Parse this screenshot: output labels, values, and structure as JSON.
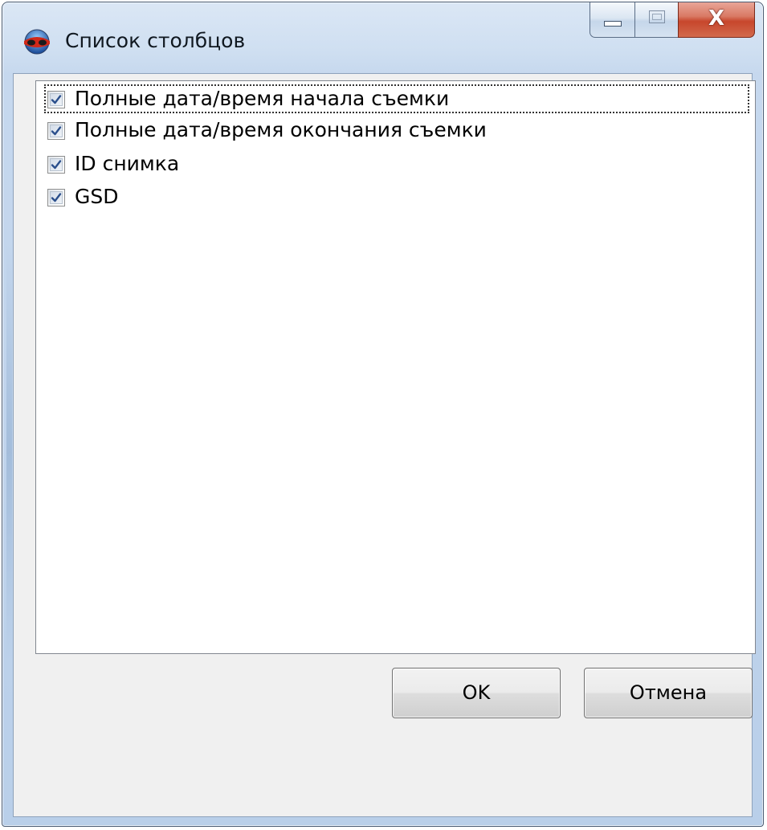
{
  "window": {
    "title": "Список столбцов",
    "icon": "app-eye-icon",
    "caption_buttons": {
      "minimize_icon": "minimize-icon",
      "maximize_icon": "maximize-icon",
      "close_label": "X"
    }
  },
  "column_list": {
    "items": [
      {
        "label": "Полные дата/время начала съемки",
        "checked": true,
        "focused": true
      },
      {
        "label": "Полные дата/время окончания съемки",
        "checked": true,
        "focused": false
      },
      {
        "label": "ID снимка",
        "checked": true,
        "focused": false
      },
      {
        "label": "GSD",
        "checked": true,
        "focused": false
      }
    ]
  },
  "buttons": {
    "ok_label": "OK",
    "cancel_label": "Отмена"
  },
  "colors": {
    "frame": "#c6d8ee",
    "close_button": "#c7462c",
    "checkmark": "#2b4f8c"
  }
}
